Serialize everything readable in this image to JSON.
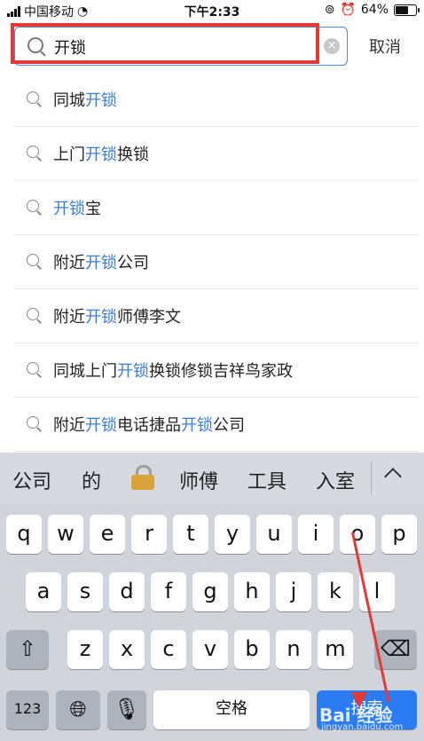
{
  "status": {
    "carrier": "中国移动",
    "time": "下午2:33",
    "battery": "64%"
  },
  "search": {
    "query": "开锁",
    "cancel_label": "取消"
  },
  "suggestions": [
    {
      "pre": "同城",
      "hl": "开锁",
      "post": "",
      "hl2": "",
      "post2": ""
    },
    {
      "pre": "上门",
      "hl": "开锁",
      "post": "换锁",
      "hl2": "",
      "post2": ""
    },
    {
      "pre": "",
      "hl": "开锁",
      "post": "宝",
      "hl2": "",
      "post2": ""
    },
    {
      "pre": "附近",
      "hl": "开锁",
      "post": "公司",
      "hl2": "",
      "post2": ""
    },
    {
      "pre": "附近",
      "hl": "开锁",
      "post": "师傅李文",
      "hl2": "",
      "post2": ""
    },
    {
      "pre": "同城上门",
      "hl": "开锁",
      "post": "换锁修锁吉祥鸟家政",
      "hl2": "",
      "post2": ""
    },
    {
      "pre": "附近",
      "hl": "开锁",
      "post": "电话捷品",
      "hl2": "开锁",
      "post2": "公司"
    }
  ],
  "keyboard": {
    "candidates": [
      "公司",
      "的",
      "师傅",
      "工具",
      "入室"
    ],
    "row1": [
      "q",
      "w",
      "e",
      "r",
      "t",
      "y",
      "u",
      "i",
      "o",
      "p"
    ],
    "row2": [
      "a",
      "s",
      "d",
      "f",
      "g",
      "h",
      "j",
      "k",
      "l"
    ],
    "row3": [
      "z",
      "x",
      "c",
      "v",
      "b",
      "n",
      "m"
    ],
    "numbers_label": "123",
    "space_label": "空格",
    "search_label": "搜索"
  },
  "watermark": {
    "brand": "Bai 经验",
    "url": "jingyan.baidu.com"
  },
  "colors": {
    "accent": "#3b7ddd",
    "highlight_frame": "#e53935",
    "search_key": "#2b7cf3"
  }
}
